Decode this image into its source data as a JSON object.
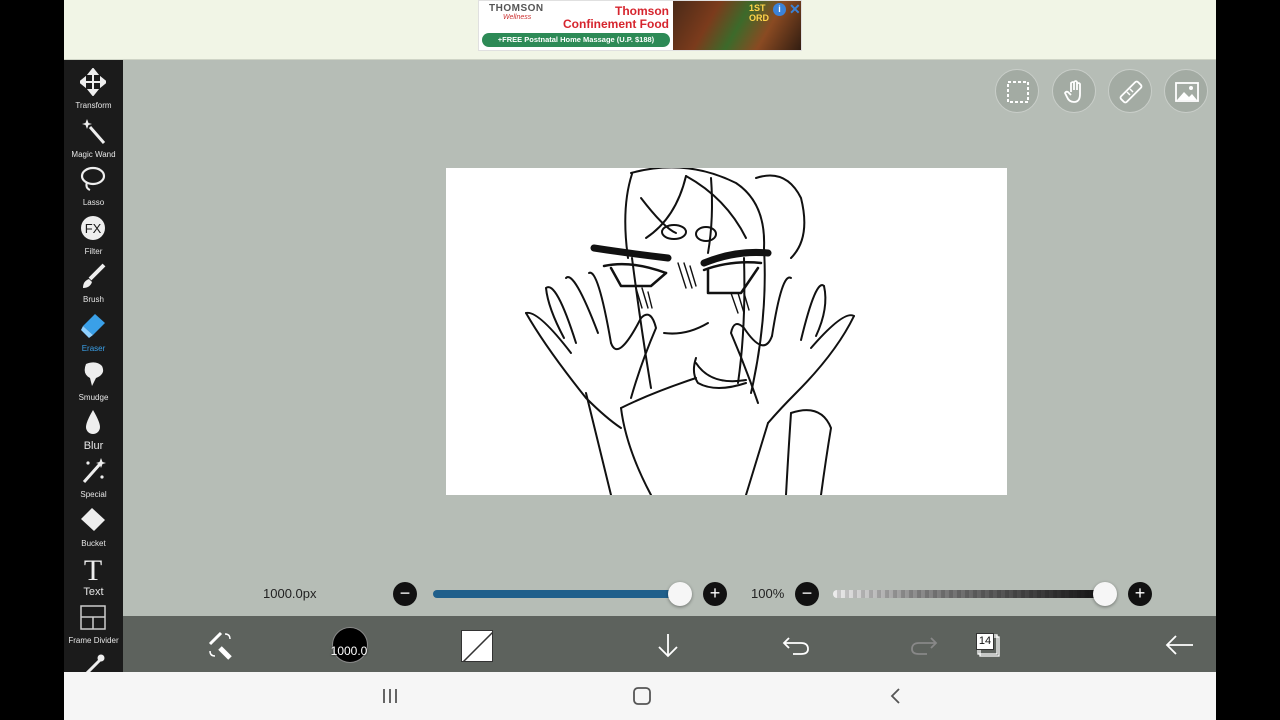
{
  "ad": {
    "brand": "THOMSON",
    "brand_sub": "Wellness",
    "headline_1": "Thomson",
    "headline_2": "Confinement Food",
    "promo": "+FREE Postnatal Home Massage (U.P. $188)",
    "order_1": "1ST",
    "order_2": "ORD",
    "info_label": "i",
    "close_label": "✕"
  },
  "toolbar": {
    "items": [
      {
        "label": "Transform",
        "icon": "move-icon"
      },
      {
        "label": "Magic Wand",
        "icon": "magic-wand-icon"
      },
      {
        "label": "Lasso",
        "icon": "lasso-icon"
      },
      {
        "label": "Filter",
        "icon": "fx-icon",
        "glyph": "FX"
      },
      {
        "label": "Brush",
        "icon": "brush-icon"
      },
      {
        "label": "Eraser",
        "icon": "eraser-icon",
        "active": true
      },
      {
        "label": "Smudge",
        "icon": "smudge-icon"
      },
      {
        "label": "Blur",
        "icon": "blur-drop-icon"
      },
      {
        "label": "Special",
        "icon": "special-wand-icon"
      },
      {
        "label": "Bucket",
        "icon": "bucket-icon"
      },
      {
        "label": "Text",
        "icon": "text-icon",
        "glyph": "T"
      },
      {
        "label": "Frame Divider",
        "icon": "frame-divider-icon"
      }
    ]
  },
  "sliders": {
    "size_label": "1000.0px",
    "size_level": 1.0,
    "opacity_label": "100%",
    "opacity_level": 1.0,
    "minus": "−",
    "plus": "+"
  },
  "bottombar": {
    "brush_size": "1000.0",
    "layer_count": "14"
  },
  "colors": {
    "accent": "#3aa0e8",
    "size_track": "#1f5f8b",
    "toolbar_bg": "#1b1b1b",
    "canvas_bg": "#b6bdb6",
    "bottombar_bg": "#5d625d"
  }
}
